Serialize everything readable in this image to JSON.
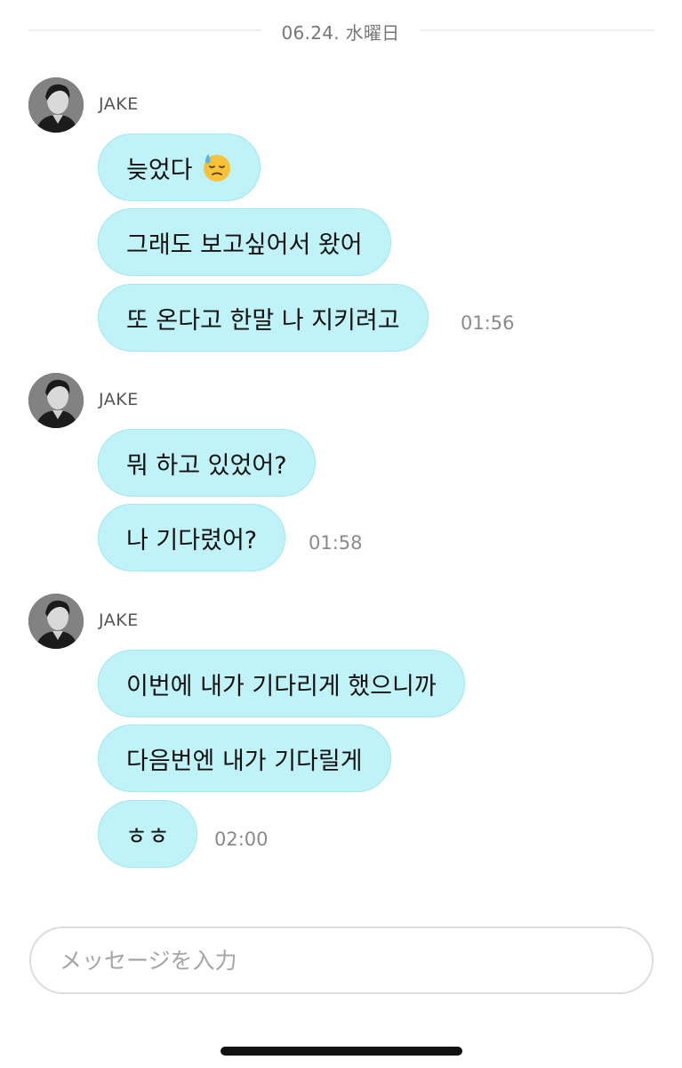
{
  "date_separator": "06.24. 水曜日",
  "groups": [
    {
      "sender": "JAKE",
      "messages": [
        "늦었다",
        "그래도 보고싶어서 왔어",
        "또 온다고 한말 나 지키려고"
      ],
      "time": "01:56"
    },
    {
      "sender": "JAKE",
      "messages": [
        "뭐 하고 있었어?",
        "나 기다렸어?"
      ],
      "time": "01:58"
    },
    {
      "sender": "JAKE",
      "messages": [
        "이번에 내가 기다리게 했으니까",
        "다음번엔 내가 기다릴게",
        "ㅎㅎ"
      ],
      "time": "02:00"
    }
  ],
  "icons": {
    "avatar": "avatar-photo-icon",
    "emoji": "sweat-face-emoji-icon"
  },
  "composer": {
    "placeholder": "メッセージを入力"
  },
  "colors": {
    "bubble_bg": "#bff3f7",
    "bubble_border": "#9fe7ee",
    "time_text": "#8a8a8a"
  }
}
